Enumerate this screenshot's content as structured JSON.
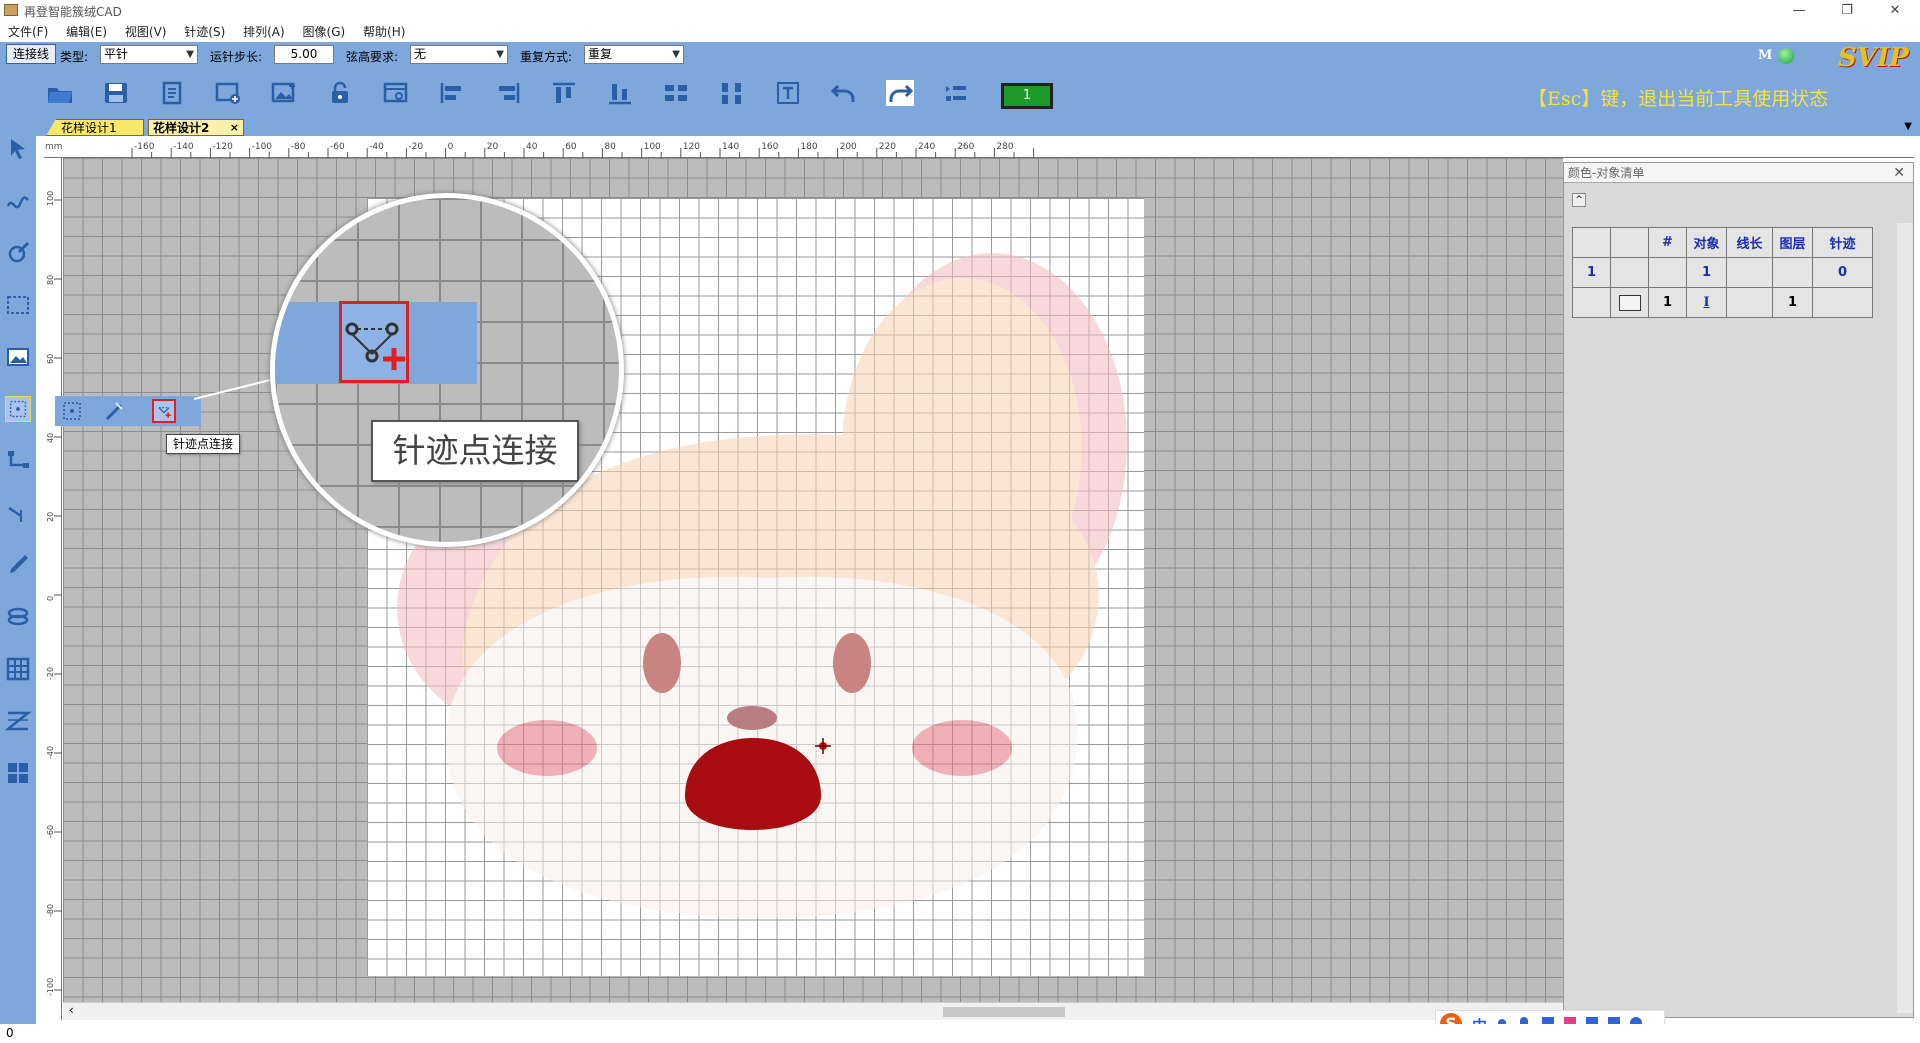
{
  "window": {
    "title": "再登智能簇绒CAD"
  },
  "menu": [
    "文件(F)",
    "编辑(E)",
    "视图(V)",
    "针迹(S)",
    "排列(A)",
    "图像(G)",
    "帮助(H)"
  ],
  "params": {
    "mode_button": "连接线",
    "type_label": "类型:",
    "type_value": "平针",
    "step_label": "运针步长:",
    "step_value": "5.00",
    "sag_label": "弦高要求:",
    "sag_value": "无",
    "repeat_label": "重复方式:",
    "repeat_value": "重复"
  },
  "status": {
    "m_label": "M",
    "svip": "SVIP",
    "green_value": "1"
  },
  "esc_hint": "【Esc】键，退出当前工具使用状态",
  "tabs": [
    {
      "label": "花样设计1"
    },
    {
      "label": "花样设计2"
    }
  ],
  "tab_close": "×",
  "ruler": {
    "unit": "mm",
    "h_ticks": [
      "-160",
      "-140",
      "-120",
      "-100",
      "-80",
      "-60",
      "-40",
      "-20",
      "0",
      "20",
      "40",
      "60",
      "80",
      "100",
      "120",
      "140",
      "160",
      "180",
      "200",
      "220",
      "240",
      "260",
      "280"
    ],
    "v_ticks": [
      "100",
      "80",
      "60",
      "40",
      "20",
      "0",
      "-20",
      "-40",
      "-60",
      "-80",
      "-100"
    ]
  },
  "tooltip": "针迹点连接",
  "magnifier_tooltip": "针迹点连接",
  "panel": {
    "title": "颜色-对象清单",
    "headers": [
      "",
      "",
      "#",
      "对象",
      "线长",
      "图层",
      "针迹"
    ],
    "rows": [
      [
        "1",
        "",
        "",
        "1",
        "",
        "",
        "0"
      ],
      [
        "",
        "",
        "1",
        "I",
        "",
        "1",
        ""
      ]
    ]
  },
  "statusbar": {
    "text": "0"
  },
  "ime": {
    "logo": "S",
    "lang": "中"
  },
  "colors": {
    "accent": "#7ea7dc",
    "selection": "#e02020",
    "esc_text": "#f6e23c"
  }
}
